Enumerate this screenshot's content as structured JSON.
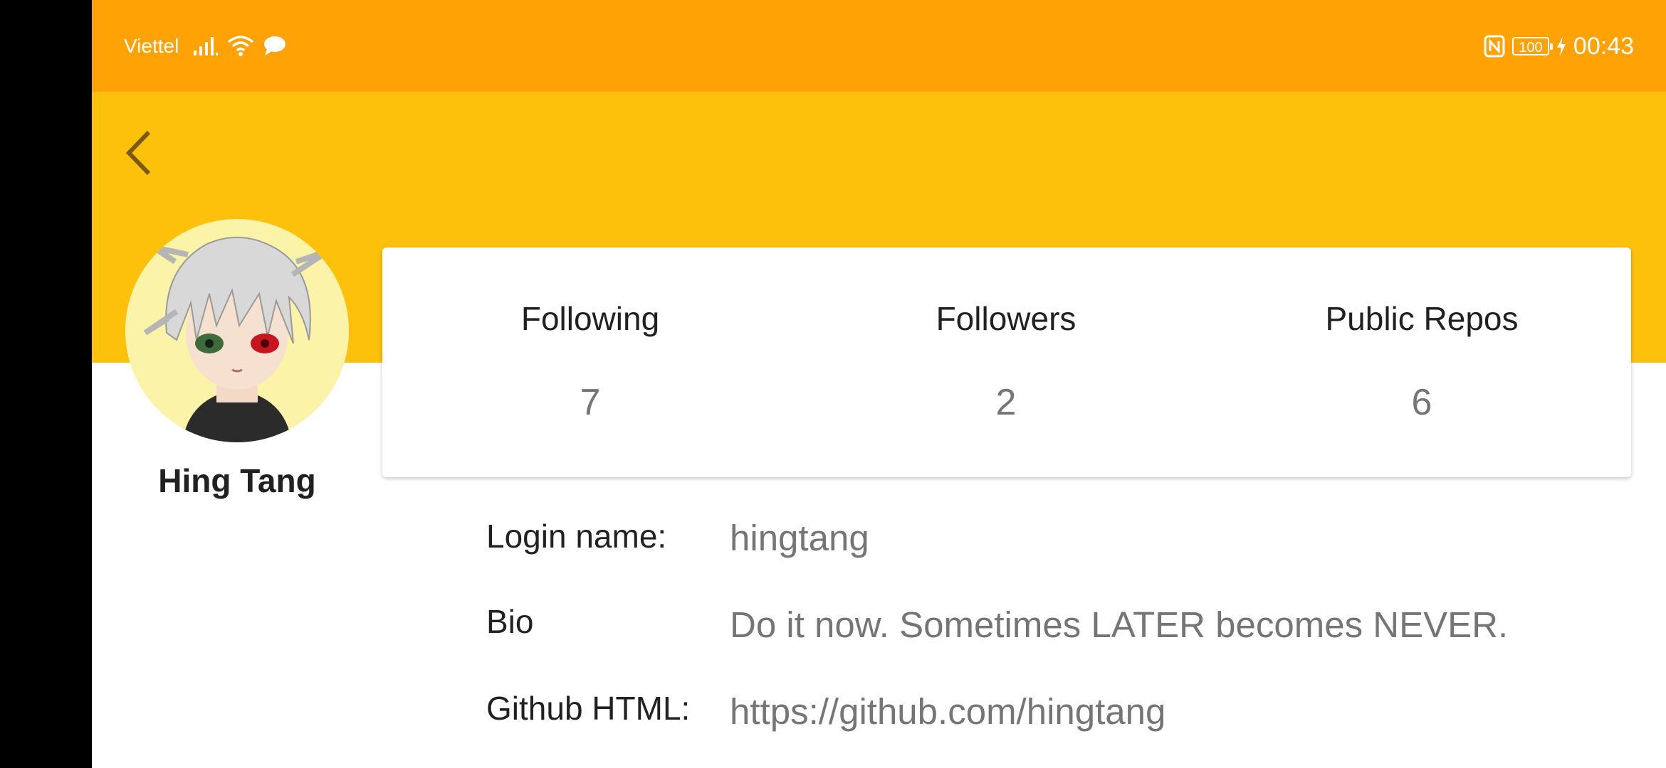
{
  "status_bar": {
    "carrier": "Viettel",
    "battery": "100",
    "time": "00:43",
    "icons": [
      "signal-icon",
      "wifi-icon",
      "message-icon",
      "nfc-icon",
      "battery-icon",
      "charging-icon"
    ]
  },
  "toolbar": {
    "back_icon": "chevron-left-icon"
  },
  "profile": {
    "name": "Hing Tang"
  },
  "stats": [
    {
      "label": "Following",
      "value": "7"
    },
    {
      "label": "Followers",
      "value": "2"
    },
    {
      "label": "Public Repos",
      "value": "6"
    }
  ],
  "details": {
    "login": {
      "label": "Login name:",
      "value": "hingtang"
    },
    "bio": {
      "label": "Bio",
      "value": "Do it now. Sometimes LATER becomes NEVER."
    },
    "github": {
      "label": "Github HTML:",
      "value": "https://github.com/hingtang"
    }
  },
  "colors": {
    "status_bar": "#ffa206",
    "header": "#fdc10c",
    "back_icon": "#7a5a10",
    "primary_text": "#212121",
    "secondary_text": "#757575"
  }
}
